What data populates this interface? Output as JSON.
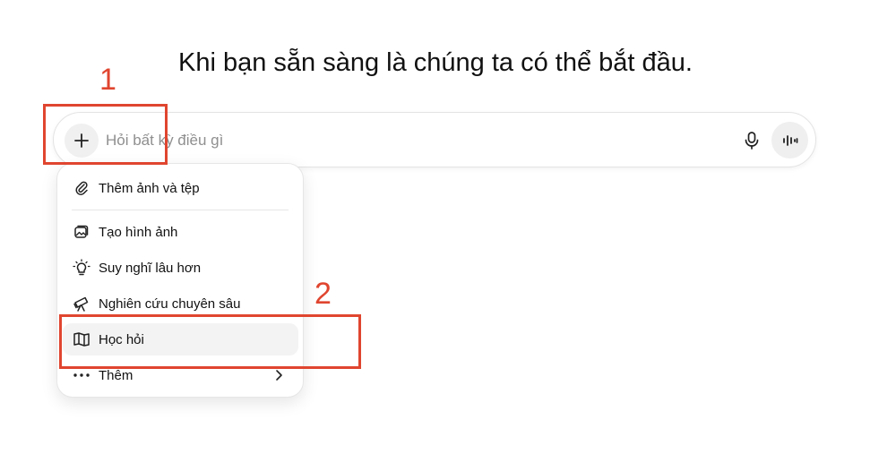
{
  "headline": "Khi bạn sẵn sàng là chúng ta có thể bắt đầu.",
  "composer": {
    "placeholder": "Hỏi bất kỳ điều gì",
    "value": ""
  },
  "menu": {
    "items": [
      {
        "label": "Thêm ảnh và tệp",
        "icon": "paperclip-icon"
      },
      {
        "label": "Tạo hình ảnh",
        "icon": "image-create-icon"
      },
      {
        "label": "Suy nghĩ lâu hơn",
        "icon": "lightbulb-icon"
      },
      {
        "label": "Nghiên cứu chuyên sâu",
        "icon": "telescope-icon"
      },
      {
        "label": "Học hỏi",
        "icon": "book-open-icon",
        "highlighted": true
      },
      {
        "label": "Thêm",
        "icon": "more-dots-icon",
        "has_submenu": true
      }
    ]
  },
  "annotations": [
    {
      "number": "1",
      "color": "#e0452f"
    },
    {
      "number": "2",
      "color": "#e0452f"
    }
  ]
}
